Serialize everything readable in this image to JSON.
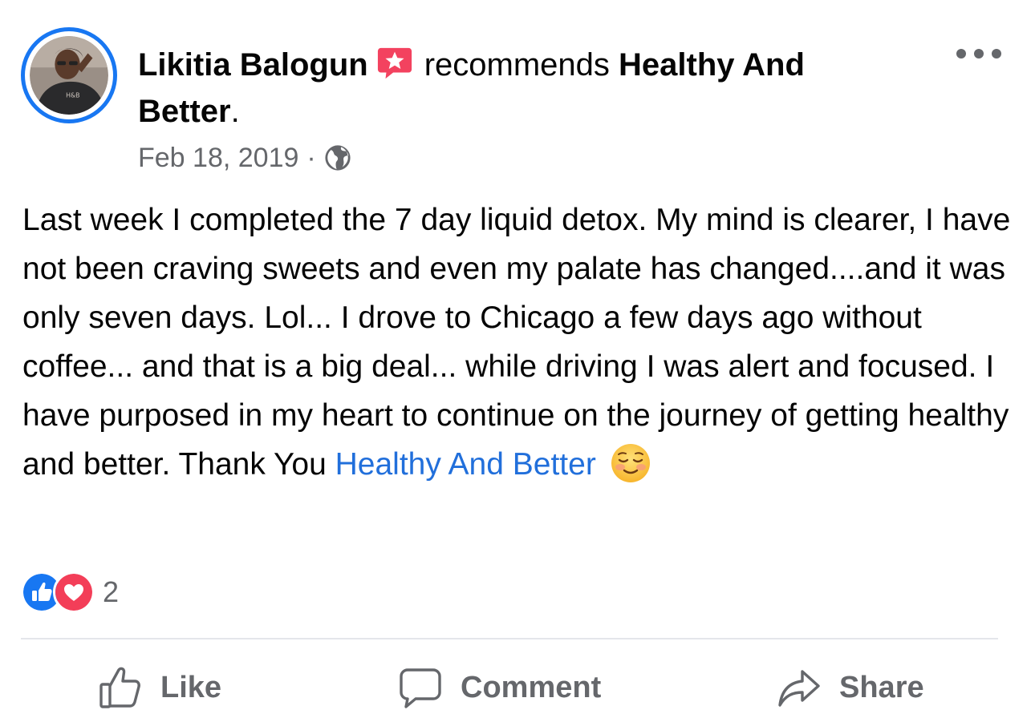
{
  "header": {
    "author_name": "Likitia Balogun",
    "action_text": "recommends",
    "page_name": "Healthy And Better",
    "period": ".",
    "date": "Feb 18, 2019",
    "separator": "·",
    "privacy_icon": "globe-icon",
    "badge_icon": "recommendation-star-icon",
    "more_icon": "more-options-icon"
  },
  "post": {
    "text": "Last week I completed the 7 day liquid detox. My mind is clearer, I have not been craving sweets and even my palate has changed....and it was only seven days. Lol... I drove to Chicago a few days ago without coffee... and that is a big deal... while driving I was alert and focused. I have purposed in my heart to continue on the journey of getting healthy and better. Thank You ",
    "mention": "Healthy And Better",
    "emoji_icon": "smiling-blushing-face-emoji"
  },
  "reactions": {
    "icons": [
      "like-reaction-icon",
      "love-reaction-icon"
    ],
    "count": "2"
  },
  "actions": {
    "like_label": "Like",
    "comment_label": "Comment",
    "share_label": "Share"
  },
  "colors": {
    "accent": "#1877f2",
    "link": "#216fdb",
    "secondary_text": "#65676b",
    "badge": "#f3425f",
    "love": "#f33e58"
  }
}
